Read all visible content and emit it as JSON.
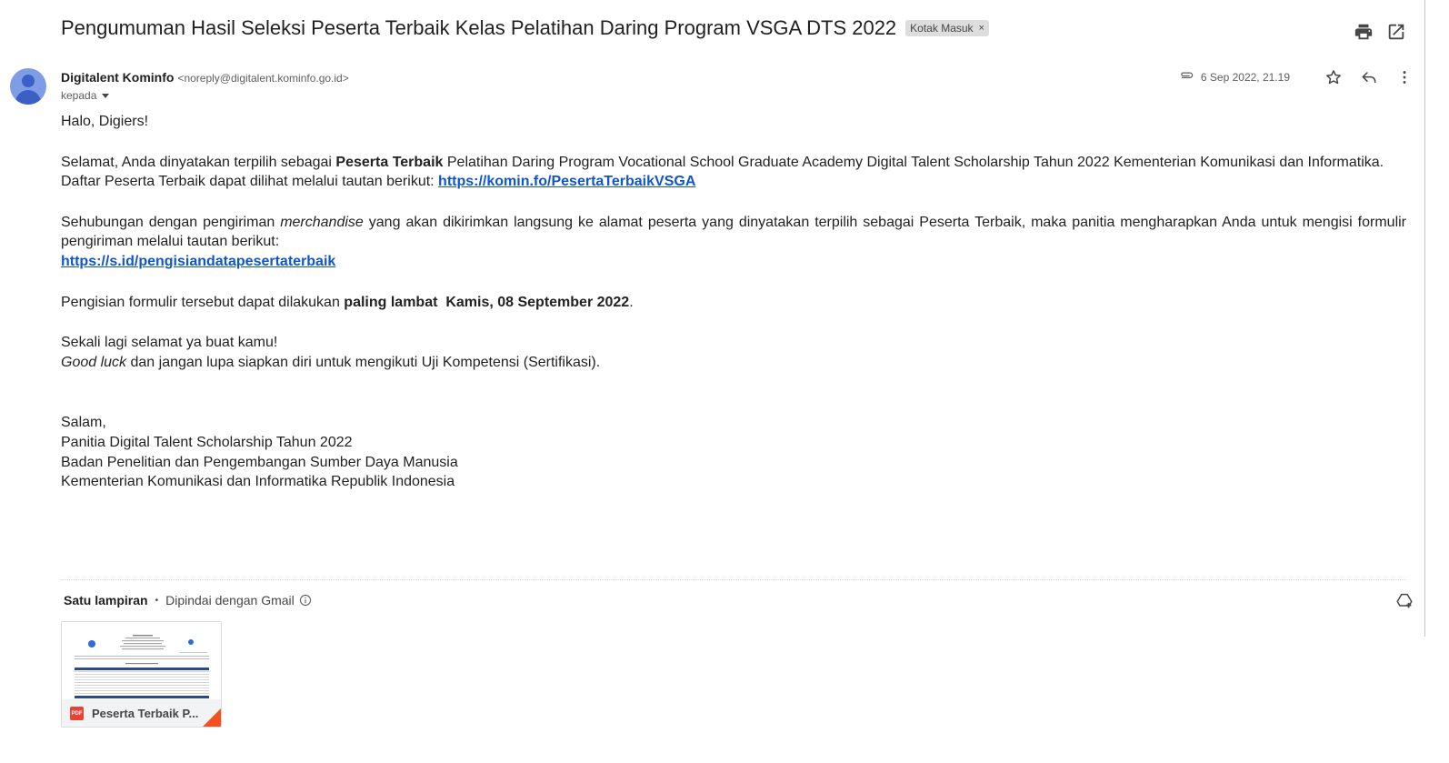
{
  "email": {
    "subject": "Pengumuman Hasil Seleksi Peserta Terbaik Kelas Pelatihan Daring Program VSGA DTS 2022",
    "label": "Kotak Masuk",
    "label_remove": "×"
  },
  "icons": {
    "print": "print-icon",
    "open_new_window": "open-in-new-window-icon",
    "attachment_clip": "paperclip-icon",
    "star": "star-icon",
    "reply": "reply-icon",
    "more": "more-vert-icon",
    "info": "info-icon",
    "add_to_drive": "add-to-drive-icon",
    "pdf": "pdf-icon"
  },
  "sender": {
    "name": "Digitalent Kominfo",
    "email": "<noreply@digitalent.kominfo.go.id>",
    "to_label": "kepada"
  },
  "meta": {
    "date": "6 Sep 2022, 21.19"
  },
  "body": {
    "greeting": "Halo, Digiers!",
    "p1_pre": "Selamat, Anda dinyatakan terpilih sebagai ",
    "p1_bold": "Peserta Terbaik",
    "p1_post": " Pelatihan Daring Program Vocational School Graduate Academy Digital Talent Scholarship Tahun 2022 Kementerian Komunikasi dan Informatika.",
    "p1_line2": "Daftar Peserta Terbaik dapat dilihat melalui tautan berikut: ",
    "p1_link": "https://komin.fo/PesertaTerbaikVSGA",
    "p2_pre": "Sehubungan dengan pengiriman ",
    "p2_italic": "merchandise",
    "p2_post": " yang akan dikirimkan langsung ke alamat peserta yang dinyatakan terpilih sebagai Peserta Terbaik, maka panitia mengharapkan Anda untuk mengisi formulir pengiriman melalui tautan berikut:",
    "p2_link": "https://s.id/pengisiandatapesertaterbaik",
    "p3_pre": "Pengisian formulir tersebut dapat dilakukan ",
    "p3_bold": "paling lambat  Kamis, 08 September 2022",
    "p3_post": ".",
    "p4_line1": "Sekali lagi selamat ya buat kamu!",
    "p4_italic": "Good luck",
    "p4_post": " dan jangan lupa siapkan diri untuk mengikuti Uji Kompetensi (Sertifikasi).",
    "sign_1": "Salam,",
    "sign_2": "Panitia Digital Talent Scholarship Tahun 2022",
    "sign_3": "Badan Penelitian dan Pengembangan Sumber Daya Manusia",
    "sign_4": "Kementerian Komunikasi dan Informatika Republik Indonesia"
  },
  "attachments": {
    "count_label": "Satu lampiran",
    "scan_label": "Dipindai dengan Gmail",
    "file_type": "PDF",
    "file_name": "Peserta Terbaik P..."
  },
  "colors": {
    "link": "#1155cc",
    "avatar": "#7f9de6",
    "pdf_red": "#e94235",
    "corner": "#f4511e"
  }
}
